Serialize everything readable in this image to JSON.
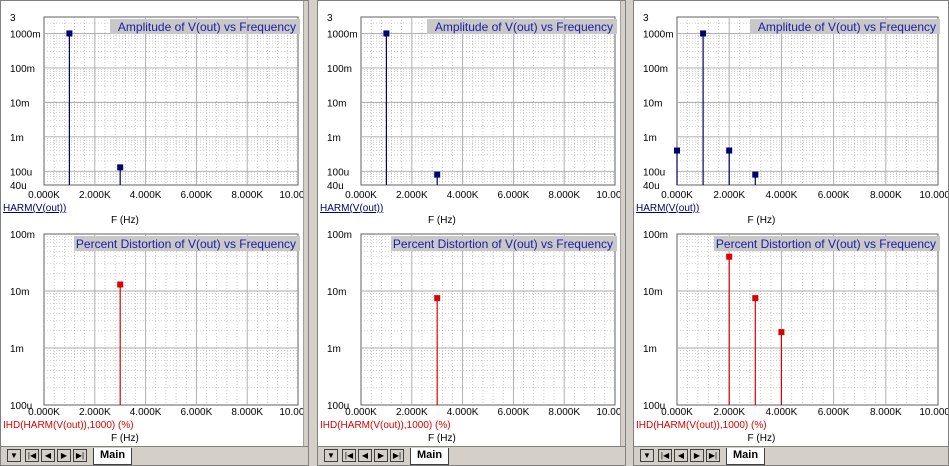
{
  "tab_label": "Main",
  "colors": {
    "amplitude": "#00006e",
    "distortion": "#dd0000",
    "title_text": "#1a1aa8",
    "grid": "#a8a8a8",
    "title_bg": "#c8c8c8"
  },
  "chart_data": [
    {
      "type": "scatter",
      "title": "Amplitude of V(out) vs Frequency",
      "xlabel": "F (Hz)",
      "trace_label": "HARM(V(out))",
      "xlim": [
        0,
        10000
      ],
      "x_ticks": [
        "0.000K",
        "2.000K",
        "4.000K",
        "6.000K",
        "8.000K",
        "10.000K"
      ],
      "y_scale": "log",
      "ylim": [
        4e-05,
        3
      ],
      "y_ticks": [
        "3",
        "1000m",
        "100m",
        "10m",
        "1m",
        "100u",
        "40u"
      ],
      "series": [
        {
          "x": [
            1000,
            3000
          ],
          "y": [
            1.0,
            0.00013
          ]
        }
      ]
    },
    {
      "type": "scatter",
      "title": "Percent Distortion of V(out) vs Frequency",
      "xlabel": "F (Hz)",
      "trace_label": "IHD(HARM(V(out)),1000) (%)",
      "xlim": [
        0,
        10000
      ],
      "x_ticks": [
        "0.000K",
        "2.000K",
        "4.000K",
        "6.000K",
        "8.000K",
        "10.000K"
      ],
      "y_scale": "log",
      "ylim": [
        0.0001,
        0.1
      ],
      "y_ticks": [
        "100m",
        "10m",
        "1m",
        "100u"
      ],
      "series": [
        {
          "x": [
            3000
          ],
          "y": [
            0.013
          ]
        }
      ]
    },
    {
      "type": "scatter",
      "title": "Amplitude of V(out) vs Frequency",
      "xlabel": "F (Hz)",
      "trace_label": "HARM(V(out))",
      "xlim": [
        0,
        10000
      ],
      "x_ticks": [
        "0.000K",
        "2.000K",
        "4.000K",
        "6.000K",
        "8.000K",
        "10.000K"
      ],
      "y_scale": "log",
      "ylim": [
        4e-05,
        3
      ],
      "y_ticks": [
        "3",
        "1000m",
        "100m",
        "10m",
        "1m",
        "100u",
        "40u"
      ],
      "series": [
        {
          "x": [
            1000,
            3000
          ],
          "y": [
            1.0,
            8e-05
          ]
        }
      ]
    },
    {
      "type": "scatter",
      "title": "Percent Distortion of V(out) vs Frequency",
      "xlabel": "F (Hz)",
      "trace_label": "IHD(HARM(V(out)),1000) (%)",
      "xlim": [
        0,
        10000
      ],
      "x_ticks": [
        "0.000K",
        "2.000K",
        "4.000K",
        "6.000K",
        "8.000K",
        "10.000K"
      ],
      "y_scale": "log",
      "ylim": [
        0.0001,
        0.1
      ],
      "y_ticks": [
        "100m",
        "10m",
        "1m",
        "100u"
      ],
      "series": [
        {
          "x": [
            3000
          ],
          "y": [
            0.0075
          ]
        }
      ]
    },
    {
      "type": "scatter",
      "title": "Amplitude of V(out) vs Frequency",
      "xlabel": "F (Hz)",
      "trace_label": "HARM(V(out))",
      "xlim": [
        0,
        10000
      ],
      "x_ticks": [
        "0.000K",
        "2.000K",
        "4.000K",
        "6.000K",
        "8.000K",
        "10.000K"
      ],
      "y_scale": "log",
      "ylim": [
        4e-05,
        3
      ],
      "y_ticks": [
        "3",
        "1000m",
        "100m",
        "10m",
        "1m",
        "100u",
        "40u"
      ],
      "series": [
        {
          "x": [
            0,
            1000,
            2000,
            3000
          ],
          "y": [
            0.0004,
            1.0,
            0.0004,
            8e-05
          ]
        }
      ]
    },
    {
      "type": "scatter",
      "title": "Percent Distortion of V(out) vs Frequency",
      "xlabel": "F (Hz)",
      "trace_label": "IHD(HARM(V(out)),1000) (%)",
      "xlim": [
        0,
        10000
      ],
      "x_ticks": [
        "0.000K",
        "2.000K",
        "4.000K",
        "6.000K",
        "8.000K",
        "10.000K"
      ],
      "y_scale": "log",
      "ylim": [
        0.0001,
        0.1
      ],
      "y_ticks": [
        "100m",
        "10m",
        "1m",
        "100u"
      ],
      "series": [
        {
          "x": [
            2000,
            3000,
            4000
          ],
          "y": [
            0.04,
            0.0075,
            0.0019
          ]
        }
      ]
    }
  ]
}
